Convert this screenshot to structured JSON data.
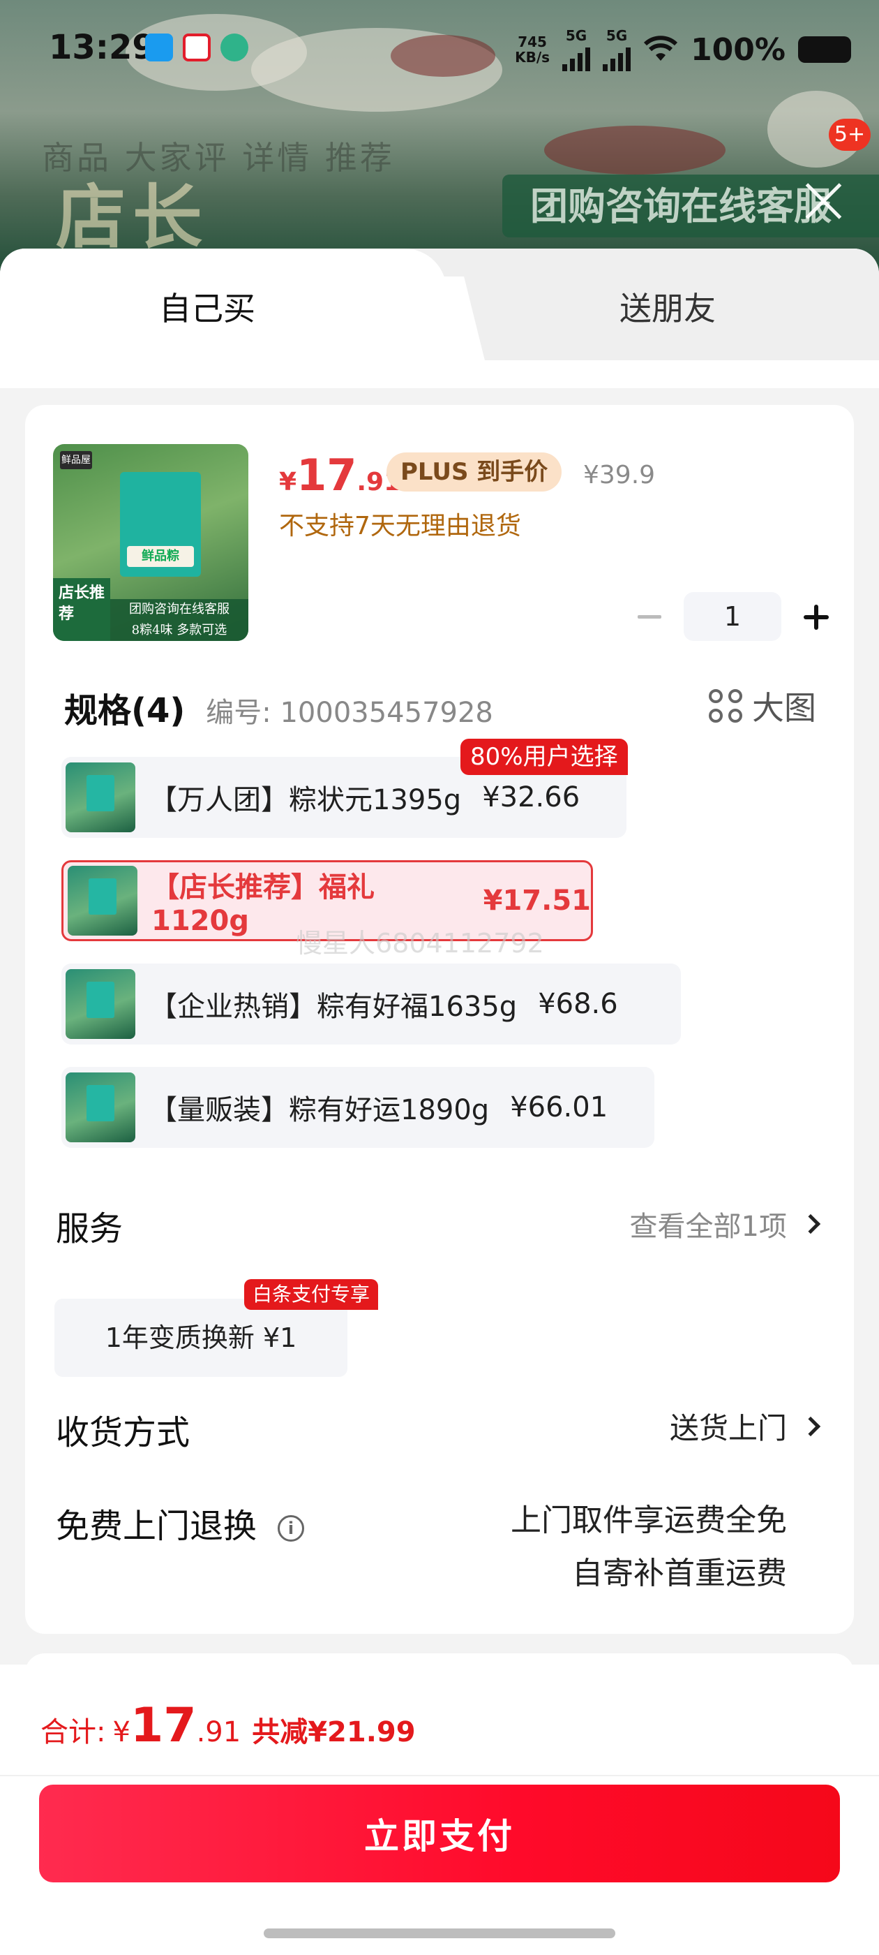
{
  "status_bar": {
    "time": "13:29",
    "net_speed_top": "745",
    "net_speed_bottom": "KB/s",
    "signal_1": "5G",
    "signal_2": "5G",
    "battery": "100%"
  },
  "background": {
    "big_text": "店长",
    "banner_text": "团购咨询在线客服",
    "faded_tabs": "商品   大家评   详情   推荐",
    "badge": "5+"
  },
  "tabs": {
    "self_buy": "自己买",
    "gift": "送朋友"
  },
  "product": {
    "thumb_brand": "鲜品屋",
    "thumb_label": "鲜品粽",
    "thumb_corner": "店长推荐",
    "thumb_strip_top": "团购咨询在线客服",
    "thumb_strip_bottom": "8粽4味 多款可选",
    "price_symbol": "¥",
    "price_int": "17",
    "price_dec": ".91",
    "plus_tag": "PLUS 到手价",
    "original_price": "¥39.9",
    "no_return_notice": "不支持7天无理由退货",
    "quantity": "1"
  },
  "spec": {
    "title": "规格(4)",
    "code": "编号: 100035457928",
    "big_image_label": "大图",
    "hot_badge": "80%用户选择",
    "watermark": "慢星人6804112792",
    "options": [
      {
        "name": "【万人团】粽状元1395g",
        "price": "¥32.66",
        "selected": false
      },
      {
        "name": "【店长推荐】福礼1120g",
        "price": "¥17.51",
        "selected": true
      },
      {
        "name": "【企业热销】粽有好福1635g",
        "price": "¥68.6",
        "selected": false
      },
      {
        "name": "【量贩装】粽有好运1890g",
        "price": "¥66.01",
        "selected": false
      }
    ]
  },
  "service": {
    "title": "服务",
    "view_all": "查看全部1项",
    "item": "1年变质换新  ¥1",
    "item_badge": "白条支付专享"
  },
  "delivery": {
    "title": "收货方式",
    "value": "送货上门"
  },
  "free_return": {
    "title": "免费上门退换",
    "line1": "上门取件享运费全免",
    "line2": "自寄补首重运费"
  },
  "footer": {
    "total_label": "合计:",
    "total_symbol": "¥",
    "total_int": "17",
    "total_dec": ".91",
    "total_saved": "共减¥21.99",
    "pay_button": "立即支付"
  }
}
